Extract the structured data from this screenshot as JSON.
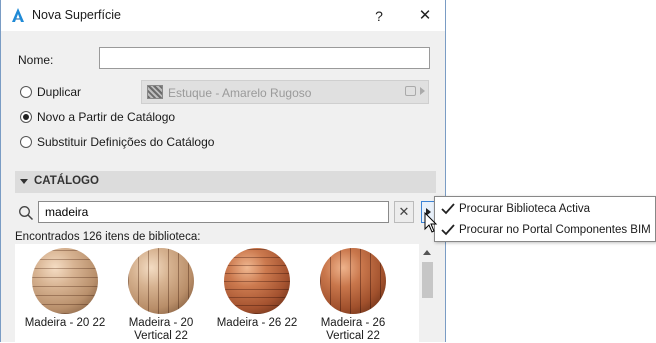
{
  "window": {
    "title": "Nova Superfície",
    "help_label": "?",
    "close_label": "✕"
  },
  "form": {
    "name_label": "Nome:",
    "name_value": "",
    "options": [
      {
        "label": "Duplicar",
        "checked": false
      },
      {
        "label": "Novo a Partir de Catálogo",
        "checked": true
      },
      {
        "label": "Substituir Definições do Catálogo",
        "checked": false
      }
    ],
    "duplicate_source": "Estuque - Amarelo Rugoso"
  },
  "catalog": {
    "section_label": "CATÁLOGO",
    "search_value": "madeira",
    "clear_label": "✕",
    "results_text": "Encontrados 126 itens de biblioteca:",
    "items": [
      {
        "line1": "Madeira - 20 22",
        "line2": ""
      },
      {
        "line1": "Madeira - 20",
        "line2": "Vertical 22"
      },
      {
        "line1": "Madeira - 26 22",
        "line2": ""
      },
      {
        "line1": "Madeira - 26",
        "line2": "Vertical 22"
      }
    ]
  },
  "popup_menu": {
    "items": [
      {
        "label": "Procurar Biblioteca Activa",
        "checked": true
      },
      {
        "label": "Procurar no Portal Componentes BIM",
        "checked": true
      }
    ]
  },
  "colors": {
    "accent": "#3d84d6",
    "wood_light": "#c9a07a",
    "wood_dark": "#a5512f"
  },
  "icons": {
    "app": "archicad-icon",
    "search": "search-icon",
    "check": "check-icon",
    "image": "image-icon"
  }
}
